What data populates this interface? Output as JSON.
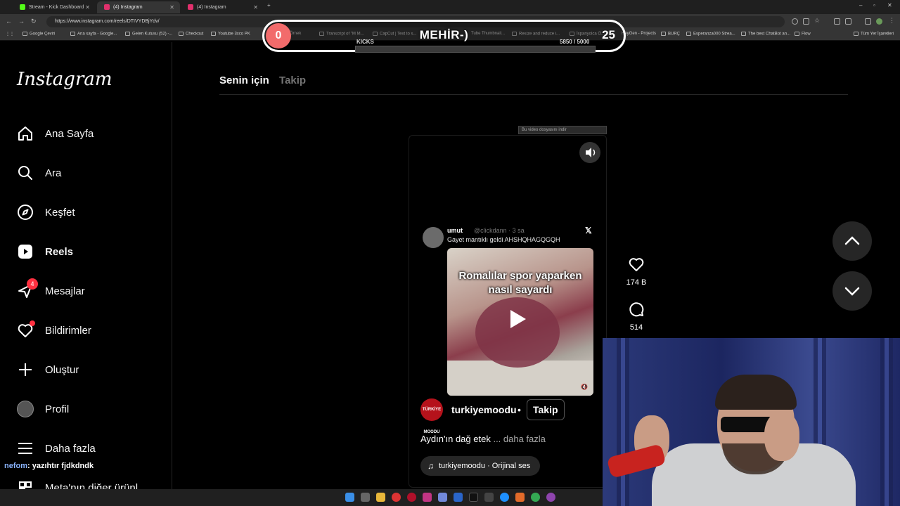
{
  "browser": {
    "tabs": [
      {
        "label": "Stream - Kick Dashboard",
        "color": "#53fc18"
      },
      {
        "label": "(4) Instagram",
        "color": "#e1306c"
      },
      {
        "label": "(4) Instagram",
        "color": "#e1306c"
      }
    ],
    "new_tab": "+",
    "url": "https://www.instagram.com/reels/DTIVYDBjYdv/",
    "bookmarks": [
      "Google Çeviri",
      "Ana sayfa - Google...",
      "Gelen Kutusu (52) -...",
      "Checkout",
      "Youtube 3xco PK",
      "Örnek",
      "Transcript of \"M M...",
      "CapCut | Text to s...",
      "Tube Thumbnail...",
      "Resize and reduce i...",
      "İspanyolca Ö...",
      "HeyGen - Projects",
      "BURÇ",
      "Esperanza000 Strea...",
      "The best ChatBot an...",
      "Flow",
      "Tüm Yer İşaretleri"
    ]
  },
  "overlay": {
    "left_value": "0",
    "title": "MEHİR-)",
    "right_value": "25",
    "kicks_label": "KICKS",
    "kicks_count": "5850",
    "kicks_total": "/ 5000",
    "kicks_progress": 1.0
  },
  "sidebar": {
    "logo": "Instagram",
    "items": [
      {
        "label": "Ana Sayfa",
        "icon": "home-icon"
      },
      {
        "label": "Ara",
        "icon": "search-icon"
      },
      {
        "label": "Keşfet",
        "icon": "compass-icon"
      },
      {
        "label": "Reels",
        "icon": "reels-icon"
      },
      {
        "label": "Mesajlar",
        "icon": "messenger-icon",
        "badge": "4"
      },
      {
        "label": "Bildirimler",
        "icon": "heart-icon"
      },
      {
        "label": "Oluştur",
        "icon": "plus-icon"
      },
      {
        "label": "Profil",
        "icon": "avatar"
      },
      {
        "label": "Daha fazla",
        "icon": "menu-icon"
      },
      {
        "label": "Meta'nın diğer ürünl",
        "icon": "meta-icon"
      }
    ]
  },
  "chat": {
    "user": "nefom",
    "message": ": yazıhtır fjdkdndk"
  },
  "feed": {
    "tabs": [
      {
        "label": "Senin için",
        "active": true
      },
      {
        "label": "Takip",
        "active": false
      }
    ],
    "download_bar": "Bu video dosyasını indir"
  },
  "reel": {
    "tweet": {
      "name": "umut",
      "handle": "@clickdann · 3 sa",
      "text": "Gayet mantıklı geldi AHSHQHAGQGQH"
    },
    "video_caption": "Romalılar spor yaparken nasıl sayardı",
    "account": {
      "name": "turkiyemoodu",
      "avatar_text": "TÜRKİYE MOODU",
      "separator": "•",
      "follow_label": "Takip"
    },
    "caption": "Aydın'ın dağ etek",
    "caption_more": "... daha fazla",
    "audio": "turkiyemoodu · Orijinal ses",
    "likes": "174 B",
    "comments": "514"
  },
  "colors": {
    "accent": "#ff3040",
    "overlay_badge": "#f26b6b"
  }
}
